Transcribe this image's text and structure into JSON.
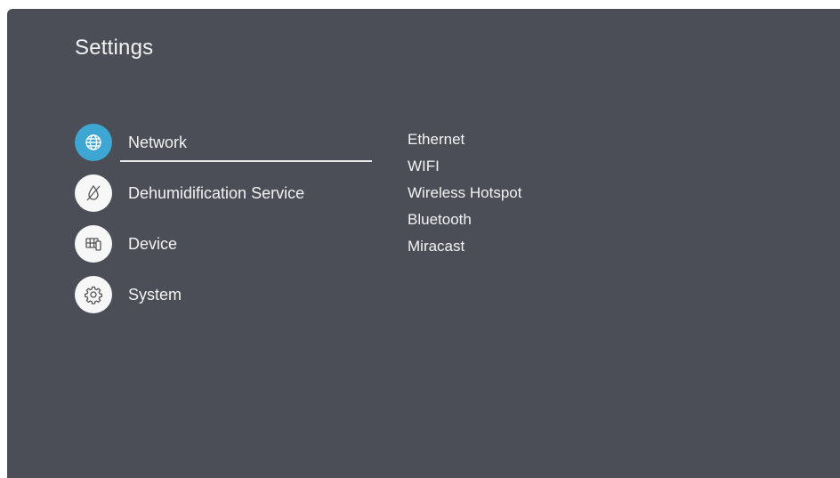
{
  "header": {
    "title": "Settings"
  },
  "menu": {
    "items": [
      {
        "label": "Network",
        "icon": "globe-icon",
        "active": true
      },
      {
        "label": "Dehumidification Service",
        "icon": "dehumidify-icon",
        "active": false
      },
      {
        "label": "Device",
        "icon": "device-icon",
        "active": false
      },
      {
        "label": "System",
        "icon": "gear-icon",
        "active": false
      }
    ]
  },
  "submenu": {
    "items": [
      "Ethernet",
      "WIFI",
      "Wireless Hotspot",
      "Bluetooth",
      "Miracast"
    ]
  },
  "colors": {
    "background": "#4b4d57",
    "accent": "#3ea6d2",
    "text": "#f3f3f3"
  }
}
